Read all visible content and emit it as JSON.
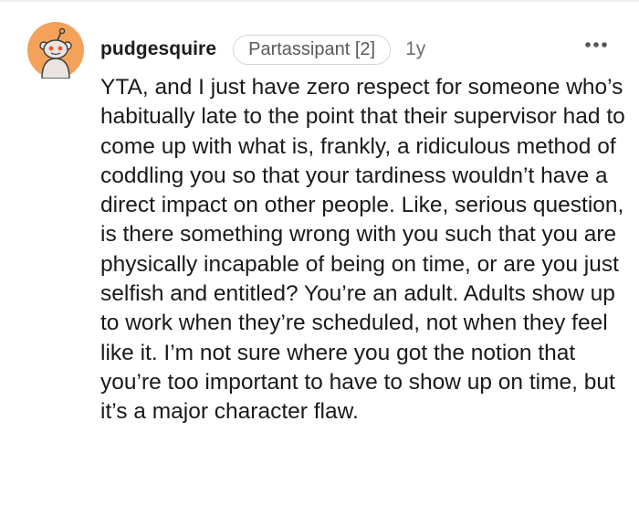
{
  "comment": {
    "username": "pudgesquire",
    "flair": "Partassipant [2]",
    "age": "1y",
    "body": "YTA, and I just have zero respect for someone who’s habitually late to the point that their supervisor had to come up with what is, frankly, a ridiculous method of coddling you so that your tardiness wouldn’t have a direct impact on other people. Like, serious question, is there something wrong with you such that you are physically incapable of being on time, or are you just selfish and entitled? You’re an adult. Adults show up to work when they’re scheduled, not when they feel like it. I’m not sure where you got the notion that you’re too important to have to show up on time, but it’s a major character flaw."
  },
  "icons": {
    "avatar": "snoo-avatar",
    "more": "more-horizontal-icon"
  },
  "colors": {
    "avatar_bg": "#f4a259",
    "text": "#1a1a1a",
    "meta": "#6e6e6e"
  }
}
